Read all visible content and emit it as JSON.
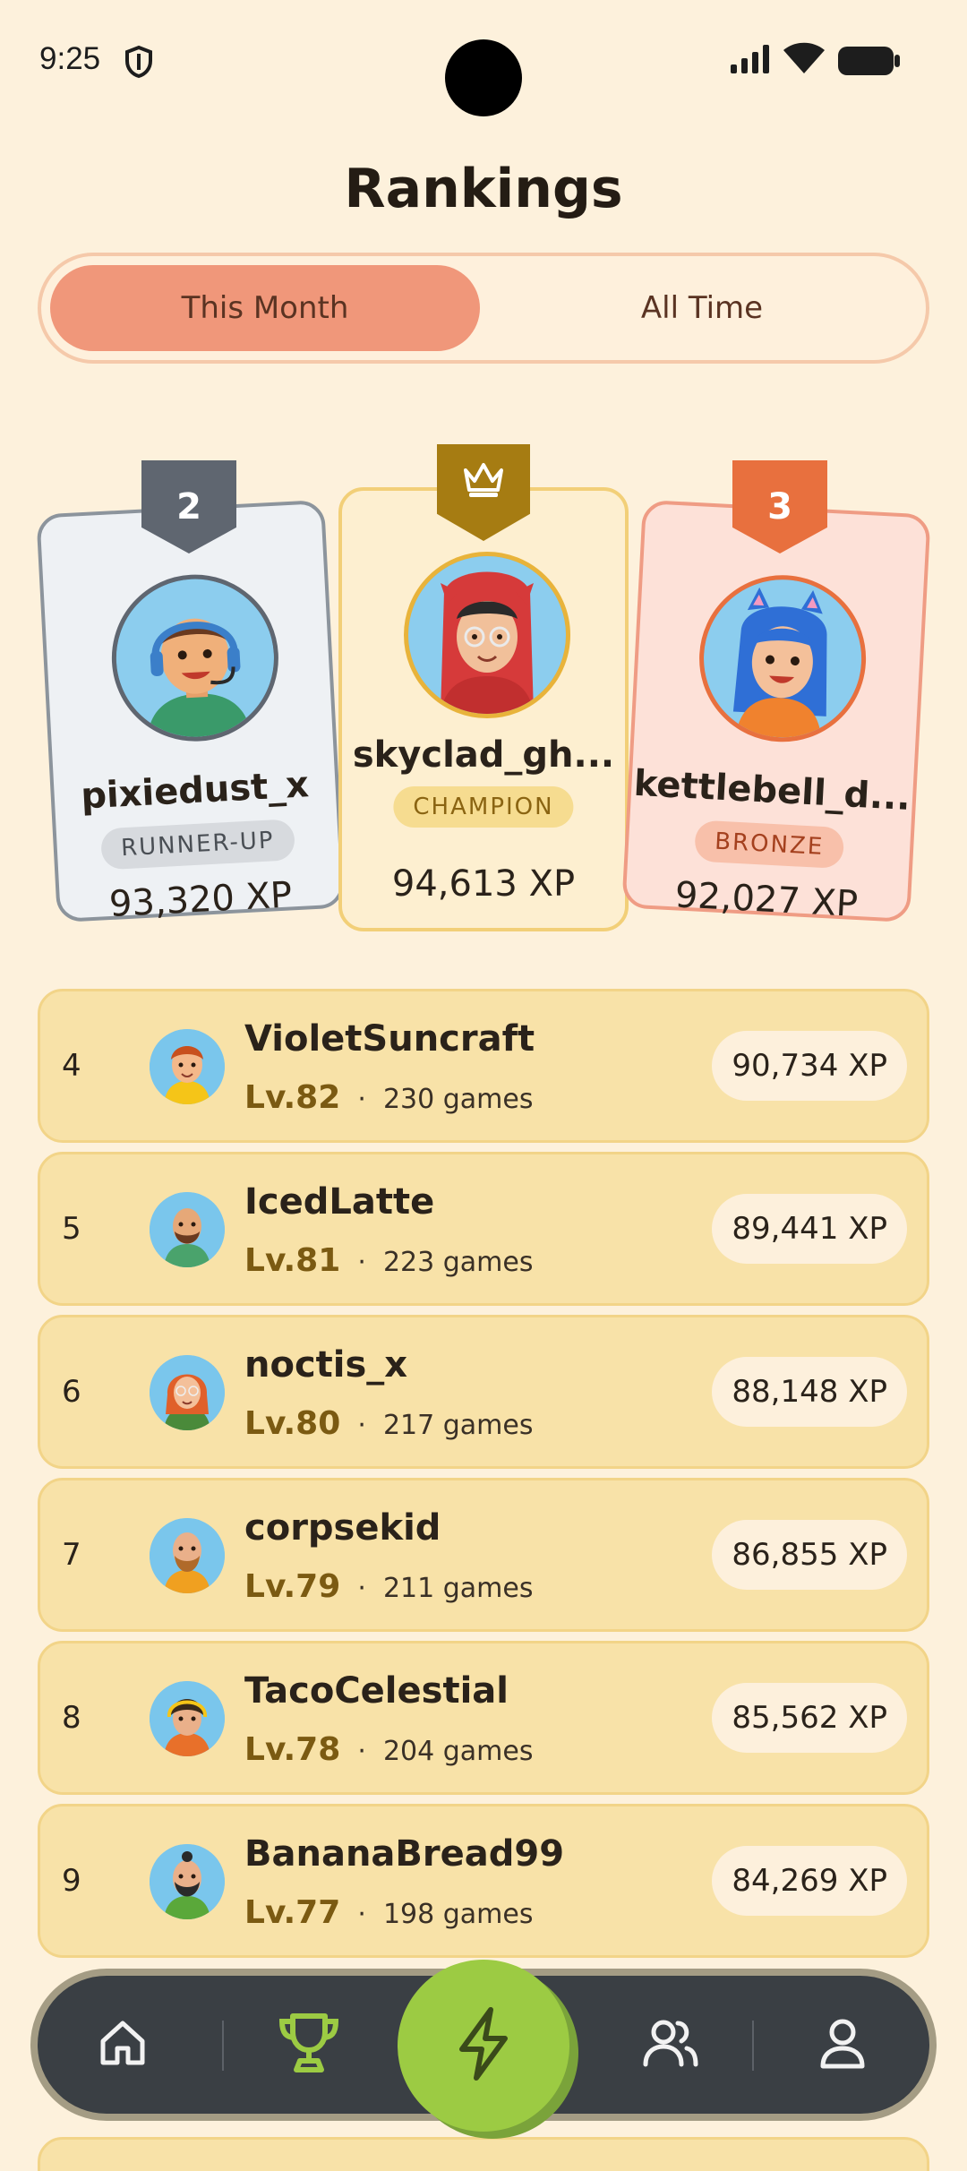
{
  "status_bar": {
    "time": "9:25"
  },
  "page_title": "Rankings",
  "tabs": [
    {
      "label": "This Month",
      "active": true
    },
    {
      "label": "All Time",
      "active": false
    }
  ],
  "podium": {
    "second": {
      "rank": "2",
      "username": "pixiedust_x",
      "title": "RUNNER-UP",
      "xp": "93,320 XP"
    },
    "first": {
      "username": "skyclad_gh...",
      "title": "CHAMPION",
      "xp": "94,613 XP",
      "icon": "crown-icon"
    },
    "third": {
      "rank": "3",
      "username": "kettlebell_d...",
      "title": "BRONZE",
      "xp": "92,027 XP"
    }
  },
  "leaderboard": [
    {
      "rank": "4",
      "username": "VioletSuncraft",
      "level": "Lv.82",
      "separator": "·",
      "games": "230 games",
      "xp": "90,734 XP"
    },
    {
      "rank": "5",
      "username": "IcedLatte",
      "level": "Lv.81",
      "separator": "·",
      "games": "223 games",
      "xp": "89,441 XP"
    },
    {
      "rank": "6",
      "username": "noctis_x",
      "level": "Lv.80",
      "separator": "·",
      "games": "217 games",
      "xp": "88,148 XP"
    },
    {
      "rank": "7",
      "username": "corpsekid",
      "level": "Lv.79",
      "separator": "·",
      "games": "211 games",
      "xp": "86,855 XP"
    },
    {
      "rank": "8",
      "username": "TacoCelestial",
      "level": "Lv.78",
      "separator": "·",
      "games": "204 games",
      "xp": "85,562 XP"
    },
    {
      "rank": "9",
      "username": "BananaBread99",
      "level": "Lv.77",
      "separator": "·",
      "games": "198 games",
      "xp": "84,269 XP"
    }
  ],
  "bottom_nav": {
    "items": [
      "home-icon",
      "trophy-icon",
      "lightning-icon",
      "friends-icon",
      "profile-icon"
    ],
    "active": "trophy-icon"
  },
  "colors": {
    "background": "#fdf1dc",
    "active_tab": "#f0977a",
    "row_bg": "#f8e2a8",
    "champion_badge": "#a67c12",
    "bronze_badge": "#e8703e",
    "silver_badge": "#5f6670",
    "fab": "#9ccb43"
  }
}
